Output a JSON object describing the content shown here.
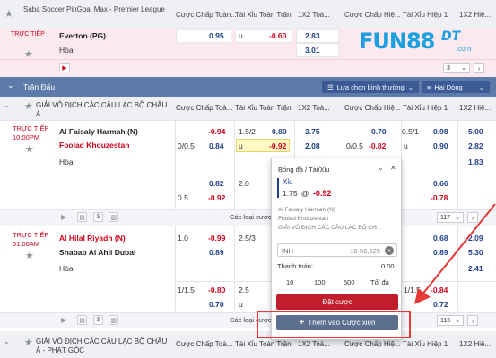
{
  "header": {
    "league": "Saba Soccer PinGoal Max - Premier League",
    "col_hdp_ft": "Cược Chấp Toàn...",
    "col_ou_ft": "Tài Xỉu Toàn Trận",
    "col_1x2_ft": "1X2 Toà...",
    "col_hdp_h1": "Cược Chấp Hiệ...",
    "col_ou_h1": "Tài Xỉu Hiệp 1",
    "col_1x2_h1": "1X2 Hiệ..."
  },
  "match0": {
    "status": "TRỰC TIẾP",
    "home": "Everton (PG)",
    "draw": "Hòa",
    "hdp_odd": "0.95",
    "ou_u": "u",
    "ou_odd": "-0.60",
    "x_home": "2.83",
    "x_draw": "3.01",
    "count": "3"
  },
  "logo": {
    "main": "FUN88",
    "sup": "DT",
    "sub": ".com"
  },
  "bar": {
    "title": "Trận Đấu",
    "filter": "Lựa chọn bình thường",
    "lines": "Hai Dòng"
  },
  "league2": {
    "name": "GIẢI VÔ ĐỊCH CÁC CÂU LẠC BỘ CHÂU Á",
    "col_hdp_ft": "Cược Chấp Toà...",
    "col_ou_ft": "Tài Xỉu Toàn Trận",
    "col_1x2_ft": "1X2 Toà...",
    "col_hdp_h1": "Cược Chấp Hiệ...",
    "col_ou_h1": "Tài Xỉu Hiệp 1",
    "col_1x2_h1": "1X2 Hiệ..."
  },
  "match1": {
    "status": "TRỰC TIẾP",
    "time": "10:00PM",
    "home": "Al Faisaly Harmah (N)",
    "away": "Foolad Khouzestan",
    "draw": "Hòa",
    "r1": {
      "hdp_odd": "-0.94",
      "ou_line": "1.5/2",
      "ou_odd": "0.80",
      "x": "3.75",
      "h1_odd": "0.70",
      "h1_line": "0.5/1",
      "h1_ou": "0.98",
      "h1_x": "5.00"
    },
    "r2": {
      "hdp_line": "0/0.5",
      "hdp_odd": "0.84",
      "ou_u": "u",
      "ou_odd": "-0.92",
      "x": "2.08",
      "h1_line": "0/0.5",
      "h1_odd": "-0.82",
      "h1_u": "u",
      "h1_ou": "0.90",
      "h1_x": "2.82"
    },
    "r3": {
      "h1_x": "1.83"
    },
    "r4": {
      "hdp_odd": "0.82",
      "ou_line": "2.0",
      "h1_ou": "0.66"
    },
    "r5": {
      "hdp_line": "0.5",
      "hdp_odd": "-0.92",
      "h1_ou": "-0.78"
    },
    "more": "Các loại cược",
    "count": "117"
  },
  "match2": {
    "status": "TRỰC TIẾP",
    "time": "01:00AM",
    "home": "Al Hilal Riyadh (N)",
    "away": "Shabab Al Ahli Dubai",
    "draw": "Hòa",
    "r1": {
      "hdp_line": "1.0",
      "hdp_odd": "-0.99",
      "ou_line": "2.5/3",
      "h1_odd": "0.68",
      "h1_x": "2.09"
    },
    "r2": {
      "hdp_odd": "0.89",
      "h1_odd": "0.89",
      "h1_x": "5.30"
    },
    "r3": {
      "h1_x": "2.41"
    },
    "r4": {
      "hdp_line": "1/1.5",
      "hdp_odd": "-0.80",
      "ou_line": "2.5",
      "h1_line": "1/1.5",
      "h1_odd": "-0.84"
    },
    "r5": {
      "hdp_odd": "0.70",
      "ou_u": "u",
      "h1_odd": "0.72"
    },
    "more": "Các loại cược",
    "count": "116"
  },
  "league3": {
    "name": "GIẢI VÔ ĐỊCH CÁC CÂU LẠC BỘ CHÂU Á - PHẠT GÓC",
    "col_hdp_ft": "Cược Chấp Toà...",
    "col_ou_ft": "Tài Xỉu Toàn Trận",
    "col_1x2_ft": "1X2 Toà...",
    "col_hdp_h1": "Cược Chấp Hiệ...",
    "col_ou_h1": "Tài Xỉu Hiệp 1",
    "col_1x2_h1": "1X2 Hiệ..."
  },
  "betslip": {
    "title": "Bóng đá / Tài/Xỉu",
    "selection": "Xỉu",
    "line": "1.75",
    "at": "@",
    "odds": "-0.92",
    "home": "Al Faisaly Harmah (N)",
    "away": "Foolad Khouzestan",
    "league": "GIẢI VÔ ĐỊCH CÁC CÂU LẠC BỘ CH...",
    "currency": "INH",
    "range": "10-56,625",
    "pay_label": "Thanh toán:",
    "pay_value": "0.00",
    "chips": [
      "10",
      "100",
      "500",
      "Tối đa"
    ],
    "place": "Đặt cược",
    "add_parlay": "Thêm vào Cược xiên"
  },
  "colors": {
    "accent": "#d0021b",
    "brand": "#1f3d8a",
    "highlight": "#e53935",
    "banner": "#5d7ba8"
  }
}
